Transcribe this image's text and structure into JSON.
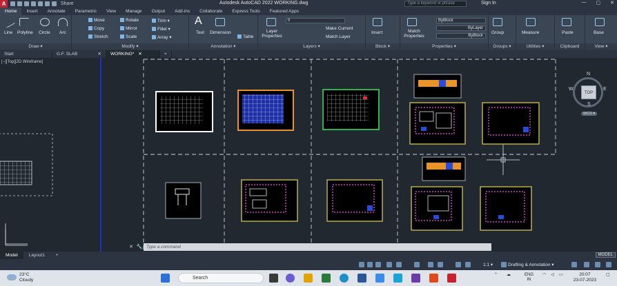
{
  "app": {
    "title": "Autodesk AutoCAD 2022   WORKING.dwg",
    "logo": "A",
    "share": "Share",
    "search_placeholder": "Type a keyword or phrase",
    "signin": "Sign In",
    "window_controls": [
      "—",
      "▢",
      "✕"
    ]
  },
  "ribbon_tabs": [
    "Home",
    "Insert",
    "Annotate",
    "Parametric",
    "View",
    "Manage",
    "Output",
    "Add-ins",
    "Collaborate",
    "Express Tools",
    "Featured Apps"
  ],
  "ribbon": {
    "draw": {
      "label": "Draw ▾",
      "line": "Line",
      "polyline": "Polyline",
      "circle": "Circle",
      "arc": "Arc"
    },
    "modify": {
      "label": "Modify ▾",
      "move": "Move",
      "rotate": "Rotate",
      "trim": "Trim ▾",
      "copy": "Copy",
      "mirror": "Mirror",
      "fillet": "Fillet ▾",
      "stretch": "Stretch",
      "scale": "Scale",
      "array": "Array ▾"
    },
    "annotation": {
      "label": "Annotation ▾",
      "text": "Text",
      "dimension": "Dimension",
      "table": "Table"
    },
    "layers": {
      "label": "Layers ▾",
      "layer_properties": "Layer Properties",
      "make_current": "Make Current",
      "match_layer": "Match Layer",
      "current_layer": "0"
    },
    "block": {
      "label": "Block ▾",
      "insert": "Insert"
    },
    "properties": {
      "label": "Properties ▾",
      "match": "Match Properties",
      "color": "ByBlock",
      "linetype": "ByLayer",
      "lineweight": "ByBlock"
    },
    "groups": {
      "label": "Groups ▾",
      "group": "Group"
    },
    "utilities": {
      "label": "Utilities ▾",
      "measure": "Measure"
    },
    "clipboard": {
      "label": "Clipboard",
      "paste": "Paste"
    },
    "view": {
      "label": "View ▾",
      "base": "Base"
    }
  },
  "file_tabs": [
    {
      "label": "Start",
      "active": false
    },
    {
      "label": "G.F. SLAB DESIGN",
      "active": false,
      "close": "✕"
    },
    {
      "label": "WORKING*",
      "active": true,
      "close": "✕"
    },
    {
      "label": "+",
      "active": false
    }
  ],
  "viewport": {
    "label": "[−][Top][2D Wireframe]",
    "viewcube": {
      "top": "TOP",
      "n": "N",
      "s": "S",
      "e": "E",
      "w": "W",
      "wcs": "WCS ▾"
    }
  },
  "command": {
    "placeholder": "Type a command",
    "close": "✕",
    "settings": "🔧"
  },
  "layout_tabs": [
    {
      "label": "Model",
      "active": true
    },
    {
      "label": "Layout1",
      "active": false
    },
    {
      "label": "+",
      "active": false
    }
  ],
  "model_badge": "MODEL",
  "status": {
    "scale": "1:1 ▾",
    "workspace": "Drafting & Annotation ▾"
  },
  "taskbar": {
    "temp": "23°C",
    "weather": "Cloudy",
    "search": "Search",
    "lang": "ENG",
    "region": "IN",
    "time": "20:07",
    "date": "23-07-2023"
  },
  "colors": {
    "frame_white": "#ffffff",
    "frame_orange": "#e8942a",
    "frame_green": "#2fb34a",
    "frame_olive": "#b8b04a",
    "sheet_magenta": "#d63cd6",
    "blue_line": "#1c2fd6"
  }
}
